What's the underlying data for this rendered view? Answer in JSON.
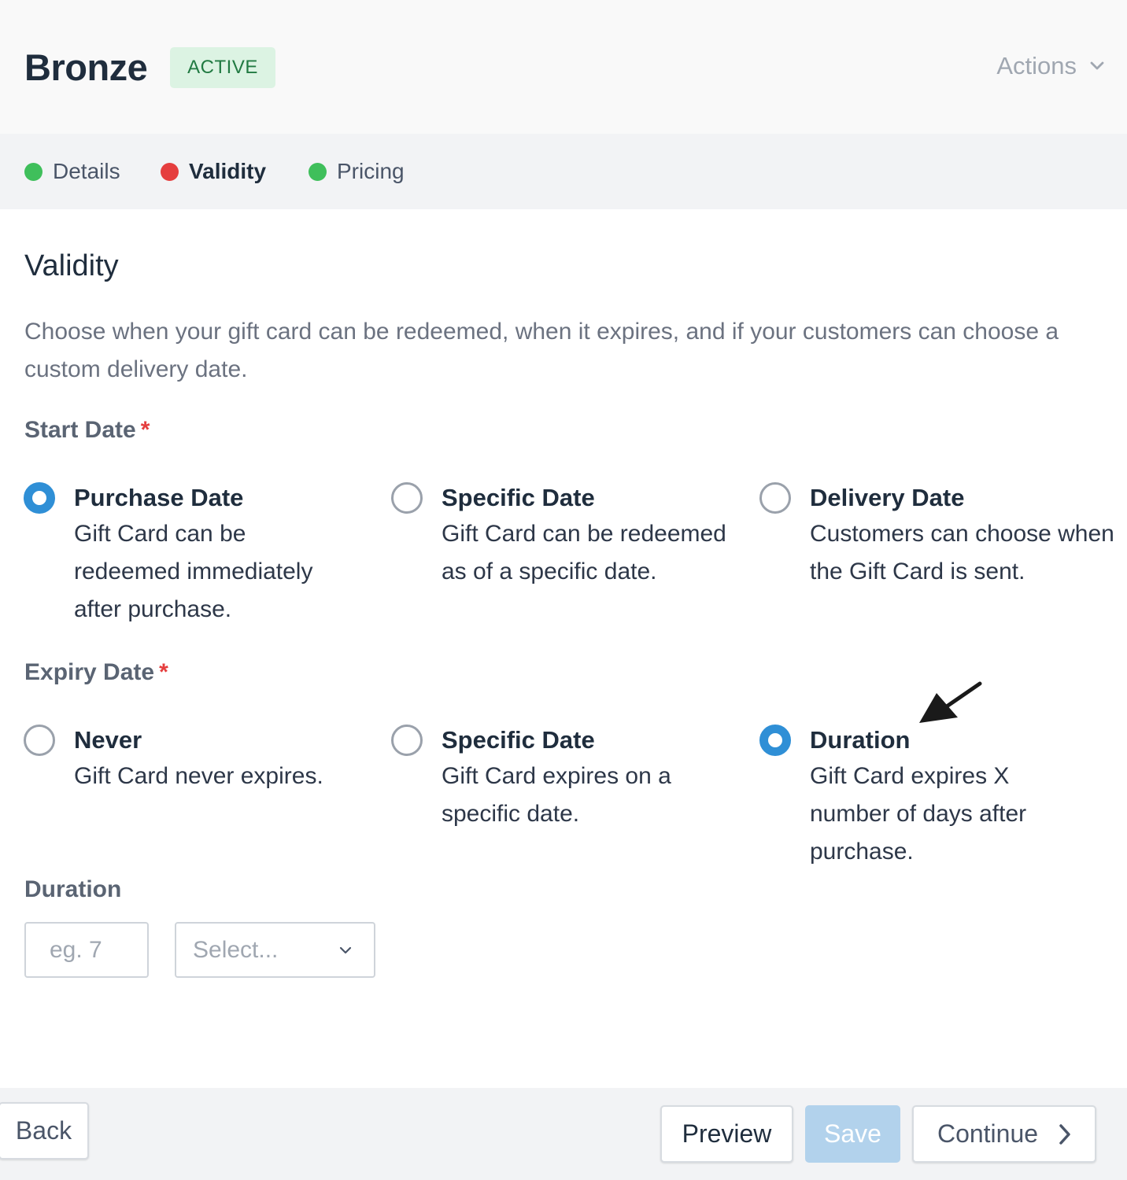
{
  "header": {
    "title": "Bronze",
    "status_badge": "ACTIVE",
    "actions_label": "Actions"
  },
  "steps": [
    {
      "label": "Details",
      "status_color": "#3fbf5b"
    },
    {
      "label": "Validity",
      "status_color": "#e53e3e"
    },
    {
      "label": "Pricing",
      "status_color": "#3fbf5b"
    }
  ],
  "section": {
    "title": "Validity",
    "description": "Choose when your gift card can be redeemed, when it expires, and if your customers can choose a custom delivery date."
  },
  "start_date": {
    "label": "Start Date",
    "required_mark": "*",
    "options": [
      {
        "title": "Purchase Date",
        "description": "Gift Card can be redeemed immediately after purchase.",
        "selected": true
      },
      {
        "title": "Specific Date",
        "description": "Gift Card can be redeemed as of a specific date.",
        "selected": false
      },
      {
        "title": "Delivery Date",
        "description": "Customers can choose when the Gift Card is sent.",
        "selected": false
      }
    ]
  },
  "expiry_date": {
    "label": "Expiry Date",
    "required_mark": "*",
    "options": [
      {
        "title": "Never",
        "description": "Gift Card never expires.",
        "selected": false
      },
      {
        "title": "Specific Date",
        "description": "Gift Card expires on a specific date.",
        "selected": false
      },
      {
        "title": "Duration",
        "description": "Gift Card expires X number of days after purchase.",
        "selected": true
      }
    ]
  },
  "duration": {
    "label": "Duration",
    "input_placeholder": "eg. 7",
    "input_value": "",
    "select_placeholder": "Select..."
  },
  "footer": {
    "back_label": "Back",
    "preview_label": "Preview",
    "save_label": "Save",
    "continue_label": "Continue"
  },
  "colors": {
    "accent": "#2f8fd6",
    "badge_bg": "#dcf3e3",
    "badge_text": "#217a42",
    "required": "#e53e3e",
    "save_disabled": "#b2d2ec"
  }
}
